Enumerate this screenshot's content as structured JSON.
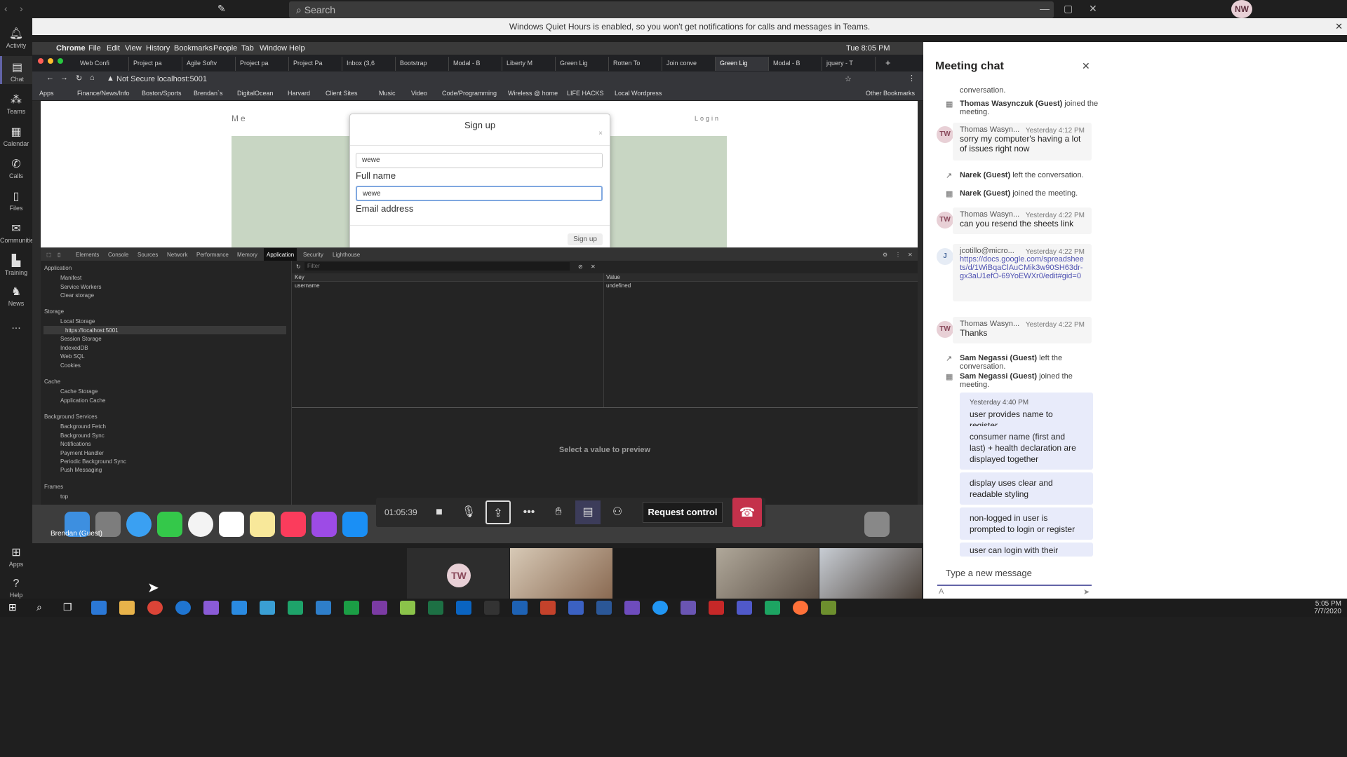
{
  "teams": {
    "search_placeholder": "Search",
    "avatar_initials": "NW",
    "rail": [
      {
        "label": "Activity"
      },
      {
        "label": "Chat"
      },
      {
        "label": "Teams"
      },
      {
        "label": "Calendar"
      },
      {
        "label": "Calls"
      },
      {
        "label": "Files"
      },
      {
        "label": "Communities"
      },
      {
        "label": "Training"
      },
      {
        "label": "News"
      },
      {
        "label": "..."
      }
    ],
    "rail_bottom": [
      {
        "label": "Apps"
      },
      {
        "label": "Help"
      }
    ],
    "quiet_hours_banner": "Windows Quiet Hours is enabled, so you won't get notifications for calls and messages in Teams."
  },
  "mac": {
    "menu": [
      "Chrome",
      "File",
      "Edit",
      "View",
      "History",
      "Bookmarks",
      "People",
      "Tab",
      "Window",
      "Help"
    ],
    "clock": "Tue 8:05 PM"
  },
  "chrome": {
    "tabs": [
      "Web Confi",
      "Project pa",
      "Agile Softv",
      "Project pa",
      "Project Pa",
      "Inbox (3,6",
      "Bootstrap",
      "Modal - B",
      "Liberty M",
      "Green Lig",
      "Rotten To",
      "Join conve",
      "Green Lig",
      "Modal - B",
      "jquery - T"
    ],
    "active_tab_index": 12,
    "not_secure": "Not Secure",
    "url": "localhost:5001",
    "bookmarks": [
      "Apps",
      "Finance/News/Info",
      "Boston/Sports",
      "Brendan`s",
      "DigitalOcean",
      "Harvard",
      "Client Sites",
      "Music",
      "Video",
      "Code/Programming",
      "Wireless @ home",
      "LIFE HACKS",
      "Local Wordpress",
      "Other Bookmarks"
    ]
  },
  "webpage": {
    "brand": "Me",
    "login": "Login",
    "modal": {
      "title": "Sign up",
      "close": "×",
      "field1_value": "wewe",
      "label1": "Full name",
      "field2_value": "wewe",
      "label2": "Email address",
      "submit": "Sign up"
    }
  },
  "devtools": {
    "tabs": [
      "Elements",
      "Console",
      "Sources",
      "Network",
      "Performance",
      "Memory",
      "Application",
      "Security",
      "Lighthouse"
    ],
    "active_tab": "Application",
    "sidebar": {
      "application_header": "Application",
      "application_items": [
        "Manifest",
        "Service Workers",
        "Clear storage"
      ],
      "storage_header": "Storage",
      "storage_items": [
        "Local Storage",
        "https://localhost:5001",
        "Session Storage",
        "IndexedDB",
        "Web SQL",
        "Cookies"
      ],
      "cache_header": "Cache",
      "cache_items": [
        "Cache Storage",
        "Application Cache"
      ],
      "bg_header": "Background Services",
      "bg_items": [
        "Background Fetch",
        "Background Sync",
        "Notifications",
        "Payment Handler",
        "Periodic Background Sync",
        "Push Messaging"
      ],
      "frames_header": "Frames",
      "frames_items": [
        "top"
      ]
    },
    "filter_placeholder": "Filter",
    "table": {
      "headers": [
        "Key",
        "Value"
      ],
      "rows": [
        [
          "username",
          "undefined"
        ]
      ]
    },
    "preview_text": "Select a value to preview"
  },
  "meeting": {
    "timer": "01:05:39",
    "request_control": "Request control",
    "presenter_label": "Brendan (Guest)",
    "video_tile_initials": "TW"
  },
  "chat": {
    "title": "Meeting chat",
    "items": [
      {
        "type": "sys",
        "text": "conversation."
      },
      {
        "type": "sys",
        "name": "Thomas Wasynczuk (Guest)",
        "text": "joined the meeting."
      },
      {
        "type": "msg",
        "initials": "TW",
        "name": "Thomas Wasyn...",
        "time": "Yesterday 4:12 PM",
        "text": "sorry my computer's having a lot of issues right now"
      },
      {
        "type": "sys",
        "name": "Narek (Guest)",
        "text": "left the conversation."
      },
      {
        "type": "sys",
        "name": "Narek (Guest)",
        "text": "joined the meeting."
      },
      {
        "type": "msg",
        "initials": "TW",
        "name": "Thomas Wasyn...",
        "time": "Yesterday 4:22 PM",
        "text": "can you resend the sheets link"
      },
      {
        "type": "msg",
        "initials": "J",
        "name": "jcotillo@micro...",
        "time": "Yesterday 4:22 PM",
        "text": "https://docs.google.com/spreadsheets/d/1WiBqaClAuCMik3w90SH63dr-gx3aU1efO-69YoEWXr0/edit#gid=0"
      },
      {
        "type": "msg",
        "initials": "TW",
        "name": "Thomas Wasyn...",
        "time": "Yesterday 4:22 PM",
        "text": "Thanks"
      },
      {
        "type": "sys",
        "name": "Sam Negassi (Guest)",
        "text": "left the conversation."
      },
      {
        "type": "sys",
        "name": "Sam Negassi (Guest)",
        "text": "joined the meeting."
      }
    ],
    "mine": [
      {
        "time": "Yesterday 4:40 PM",
        "text": "user provides name to register"
      },
      {
        "text": "consumer name (first and last) + health declaration are displayed together"
      },
      {
        "text": "display uses clear and readable styling"
      },
      {
        "text": "non-logged in user is prompted to login or register"
      },
      {
        "text": "user can login with their"
      }
    ],
    "input_placeholder": "Type a new message"
  },
  "taskbar": {
    "time": "5:05 PM",
    "date": "7/7/2020"
  }
}
